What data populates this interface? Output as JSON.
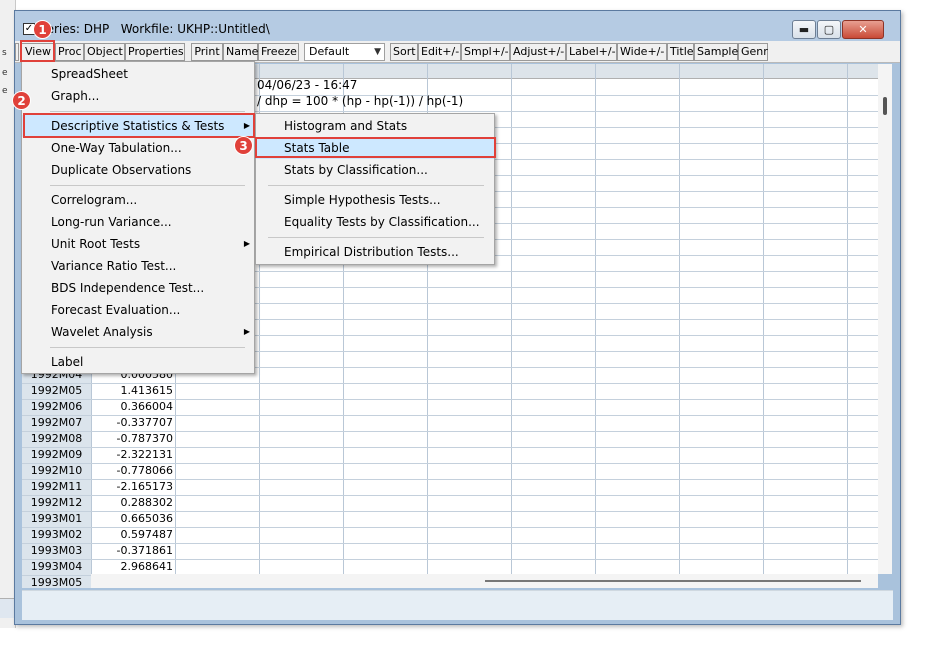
{
  "window": {
    "title": "Series: DHP   Workfile: UKHP::Untitled\\",
    "check_mark": "✓",
    "min_glyph": "▬",
    "max_glyph": "▢",
    "close_glyph": "✕"
  },
  "toolbar": {
    "items": [
      "View",
      "Proc",
      "Object",
      "Properties",
      "Print",
      "Name",
      "Freeze"
    ],
    "dropdown_value": "Default",
    "items2": [
      "Sort",
      "Edit+/-",
      "Smpl+/-",
      "Adjust+/-",
      "Label+/-",
      "Wide+/-",
      "Title",
      "Sample",
      "Genr"
    ]
  },
  "sheet": {
    "info_line1": "04/06/23 - 16:47",
    "info_line2": "/ dhp = 100 * (hp - hp(-1)) / hp(-1)",
    "partial_row_label": "1992M04",
    "partial_row_value": "0.000580",
    "rows": [
      {
        "label": "1992M05",
        "value": "1.413615"
      },
      {
        "label": "1992M06",
        "value": "0.366004"
      },
      {
        "label": "1992M07",
        "value": "-0.337707"
      },
      {
        "label": "1992M08",
        "value": "-0.787370"
      },
      {
        "label": "1992M09",
        "value": "-2.322131"
      },
      {
        "label": "1992M10",
        "value": "-0.778066"
      },
      {
        "label": "1992M11",
        "value": "-2.165173"
      },
      {
        "label": "1992M12",
        "value": "0.288302"
      },
      {
        "label": "1993M01",
        "value": "0.665036"
      },
      {
        "label": "1993M02",
        "value": "0.597487"
      },
      {
        "label": "1993M03",
        "value": "-0.371861"
      },
      {
        "label": "1993M04",
        "value": "2.968641"
      },
      {
        "label": "1993M05",
        "value": ""
      }
    ]
  },
  "view_menu": {
    "items": [
      "SpreadSheet",
      "Graph...",
      "Descriptive Statistics & Tests",
      "One-Way Tabulation...",
      "Duplicate Observations",
      "Correlogram...",
      "Long-run Variance...",
      "Unit Root Tests",
      "Variance Ratio Test...",
      "BDS Independence Test...",
      "Forecast Evaluation...",
      "Wavelet Analysis",
      "Label"
    ],
    "submenu_arrow": "▶"
  },
  "stats_submenu": {
    "items": [
      "Histogram and Stats",
      "Stats Table",
      "Stats by Classification...",
      "Simple Hypothesis Tests...",
      "Equality Tests by Classification...",
      "Empirical Distribution Tests..."
    ]
  },
  "annotations": {
    "m1": "1",
    "m2": "2",
    "m3": "3",
    "color": "#e0413a"
  },
  "background": {
    "left_bits": [
      "s",
      "e",
      "e"
    ]
  }
}
